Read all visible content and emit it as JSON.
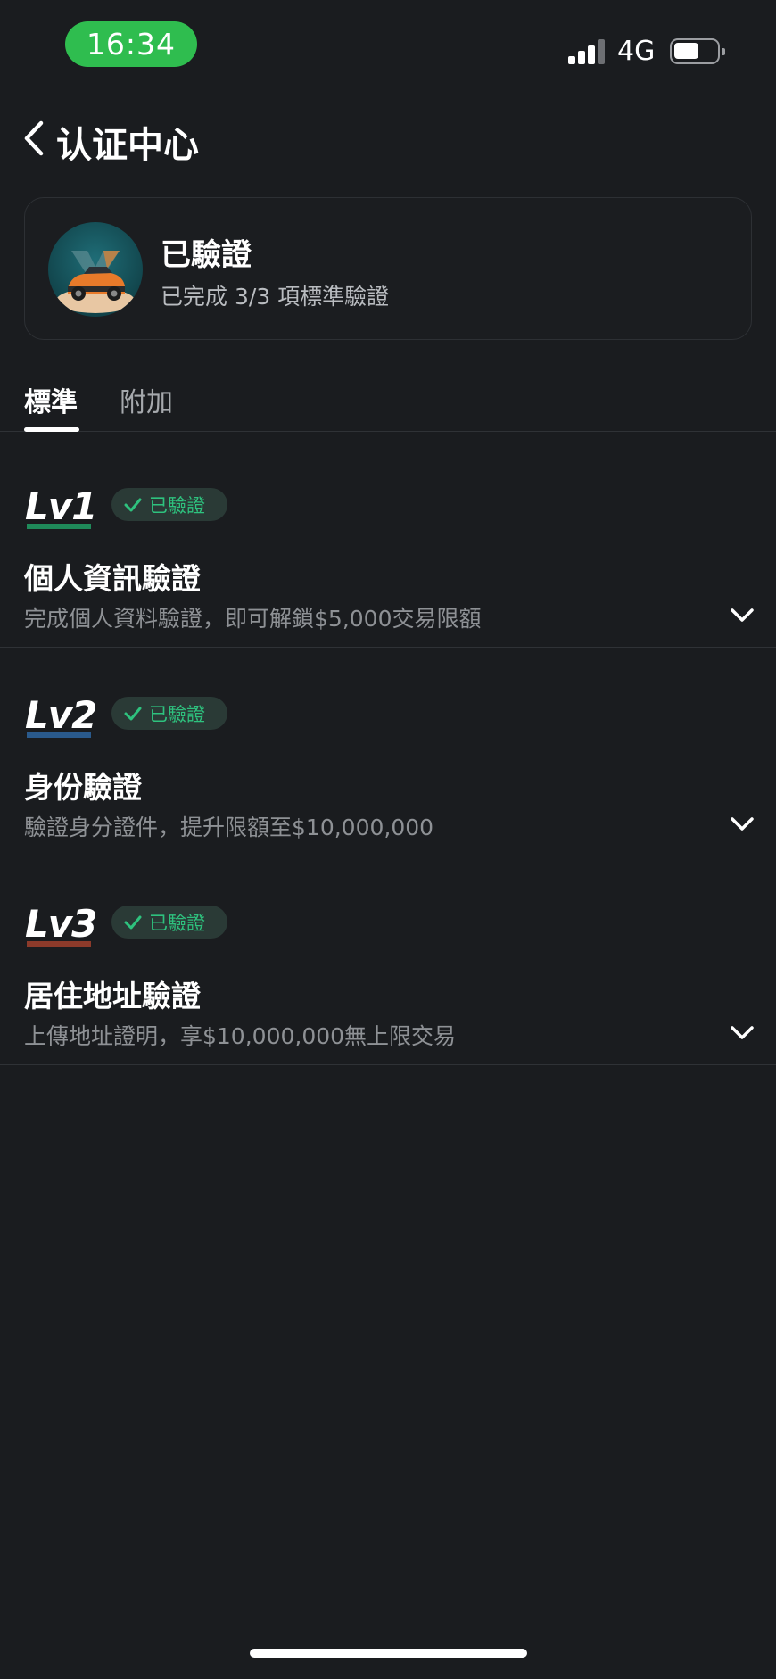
{
  "status_bar": {
    "time": "16:34",
    "network": "4G",
    "time_pill_color": "#2fbd4f",
    "battery_icon": "battery-icon",
    "signal_icon": "signal-icon"
  },
  "nav": {
    "back_icon": "chevron-left-icon",
    "title": "认证中心"
  },
  "summary": {
    "avatar_icon": "avatar-image",
    "title": "已驗證",
    "subtitle": "已完成 3/3 項標準驗證"
  },
  "tabs": [
    {
      "label": "標準",
      "active": true
    },
    {
      "label": "附加",
      "active": false
    }
  ],
  "levels": [
    {
      "badge": "Lv1",
      "badge_color": "#1f8a5a",
      "status": "已驗證",
      "title": "個人資訊驗證",
      "description": "完成個人資料驗證，即可解鎖$5,000交易限額"
    },
    {
      "badge": "Lv2",
      "badge_color": "#2a5a8c",
      "status": "已驗證",
      "title": "身份驗證",
      "description": "驗證身分證件，提升限額至$10,000,000"
    },
    {
      "badge": "Lv3",
      "badge_color": "#8c3a2a",
      "status": "已驗證",
      "title": "居住地址驗證",
      "description": "上傳地址證明，享$10,000,000無上限交易"
    }
  ],
  "colors": {
    "background": "#1a1c1f",
    "accent_green": "#2ec27e",
    "secondary_text": "#8e9195"
  }
}
